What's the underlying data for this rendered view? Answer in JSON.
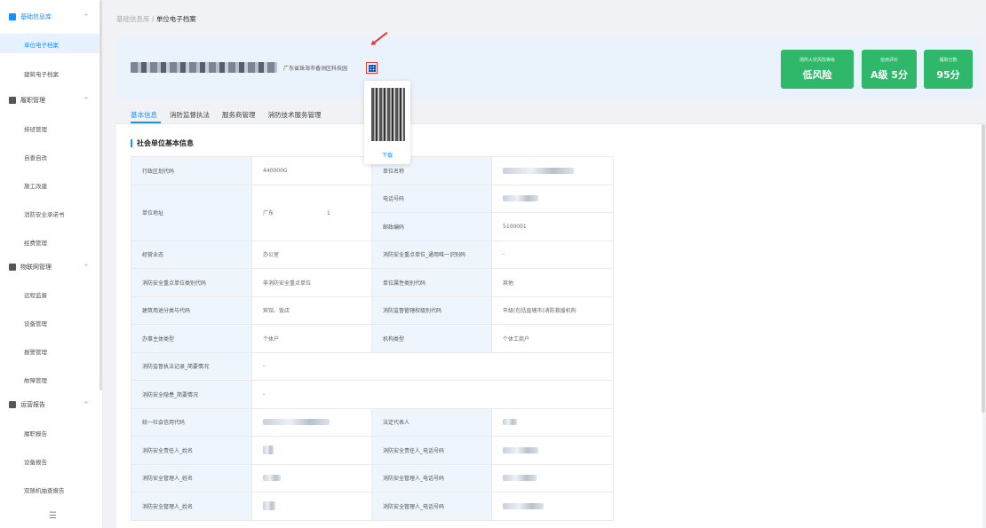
{
  "sidebar": {
    "groups": [
      {
        "label": "基础信息库",
        "items": [
          "单位电子档案",
          "建筑电子档案"
        ]
      },
      {
        "label": "履职管理",
        "items": [
          "排班管理",
          "自查自改",
          "施工改建",
          "消防安全承诺书",
          "经费管理"
        ]
      },
      {
        "label": "物联网管理",
        "items": [
          "远程监督",
          "设备管理",
          "报警管理",
          "故障管理"
        ]
      },
      {
        "label": "运营报告",
        "items": [
          "履职报告",
          "设备报告",
          "双随机抽查报告"
        ]
      }
    ],
    "chevron": "^",
    "toggle": "☰"
  },
  "breadcrumb": {
    "parent": "基础信息库",
    "separator": "/",
    "current": "单位电子档案"
  },
  "header": {
    "address": "广东省珠海市香洲区科技园",
    "cards": [
      {
        "label": "场所火灾风险等级",
        "value": "低风险"
      },
      {
        "label": "信用评价",
        "value": "A级 5分"
      },
      {
        "label": "履职分数",
        "value": "95分"
      }
    ]
  },
  "qr_popover": {
    "download_label": "下载"
  },
  "tabs": [
    "基本信息",
    "消防监督执法",
    "服务商管理",
    "消防技术服务管理"
  ],
  "section_title": "社会单位基本信息",
  "table": {
    "rows": [
      {
        "k1": "行政区划代码",
        "v1": "440000G",
        "k2": "单位名称",
        "v2": ""
      },
      {
        "k1": "单位地址",
        "v1": "广东",
        "v1b": "1",
        "k2": "电话号码",
        "v2": ""
      },
      {
        "k2": "邮政编码",
        "v2": "5100001"
      },
      {
        "k1": "经营业态",
        "v1": "办公室",
        "k2": "消防安全重点单位_通用唯一识别码",
        "v2": "-"
      },
      {
        "k1": "消防安全重点单位类别代码",
        "v1": "非消防安全重点单位",
        "k2": "单位属性类别代码",
        "v2": "其他"
      },
      {
        "k1": "建筑用途分类与代码",
        "v1": "宾馆、饭店",
        "k2": "消防监督管辖权级别代码",
        "v2": "市级(包括直辖市)消防救援机构"
      },
      {
        "k1": "办事主体类型",
        "v1": "个体户",
        "k2": "机构类型",
        "v2": "个体工商户"
      },
      {
        "k1": "消防监督执法记录_简要情况",
        "v1": "-"
      },
      {
        "k1": "消防安全隐患_简要情况",
        "v1": "-"
      },
      {
        "k1": "统一社会信用代码",
        "v1": "",
        "k2": "法定代表人",
        "v2": ""
      },
      {
        "k1": "消防安全责任人_姓名",
        "v1": "",
        "k2": "消防安全责任人_电话号码",
        "v2": ""
      },
      {
        "k1": "消防安全管理人_姓名",
        "v1": "",
        "k2": "消防安全管理人_电话号码",
        "v2": ""
      },
      {
        "k1": "消防安全管理人_姓名",
        "v1": "",
        "k2": "消防安全管理人_电话号码",
        "v2": ""
      }
    ]
  },
  "colors": {
    "accent": "#1890ff",
    "card_green": "#2fb86a",
    "highlight": "#e53935"
  }
}
